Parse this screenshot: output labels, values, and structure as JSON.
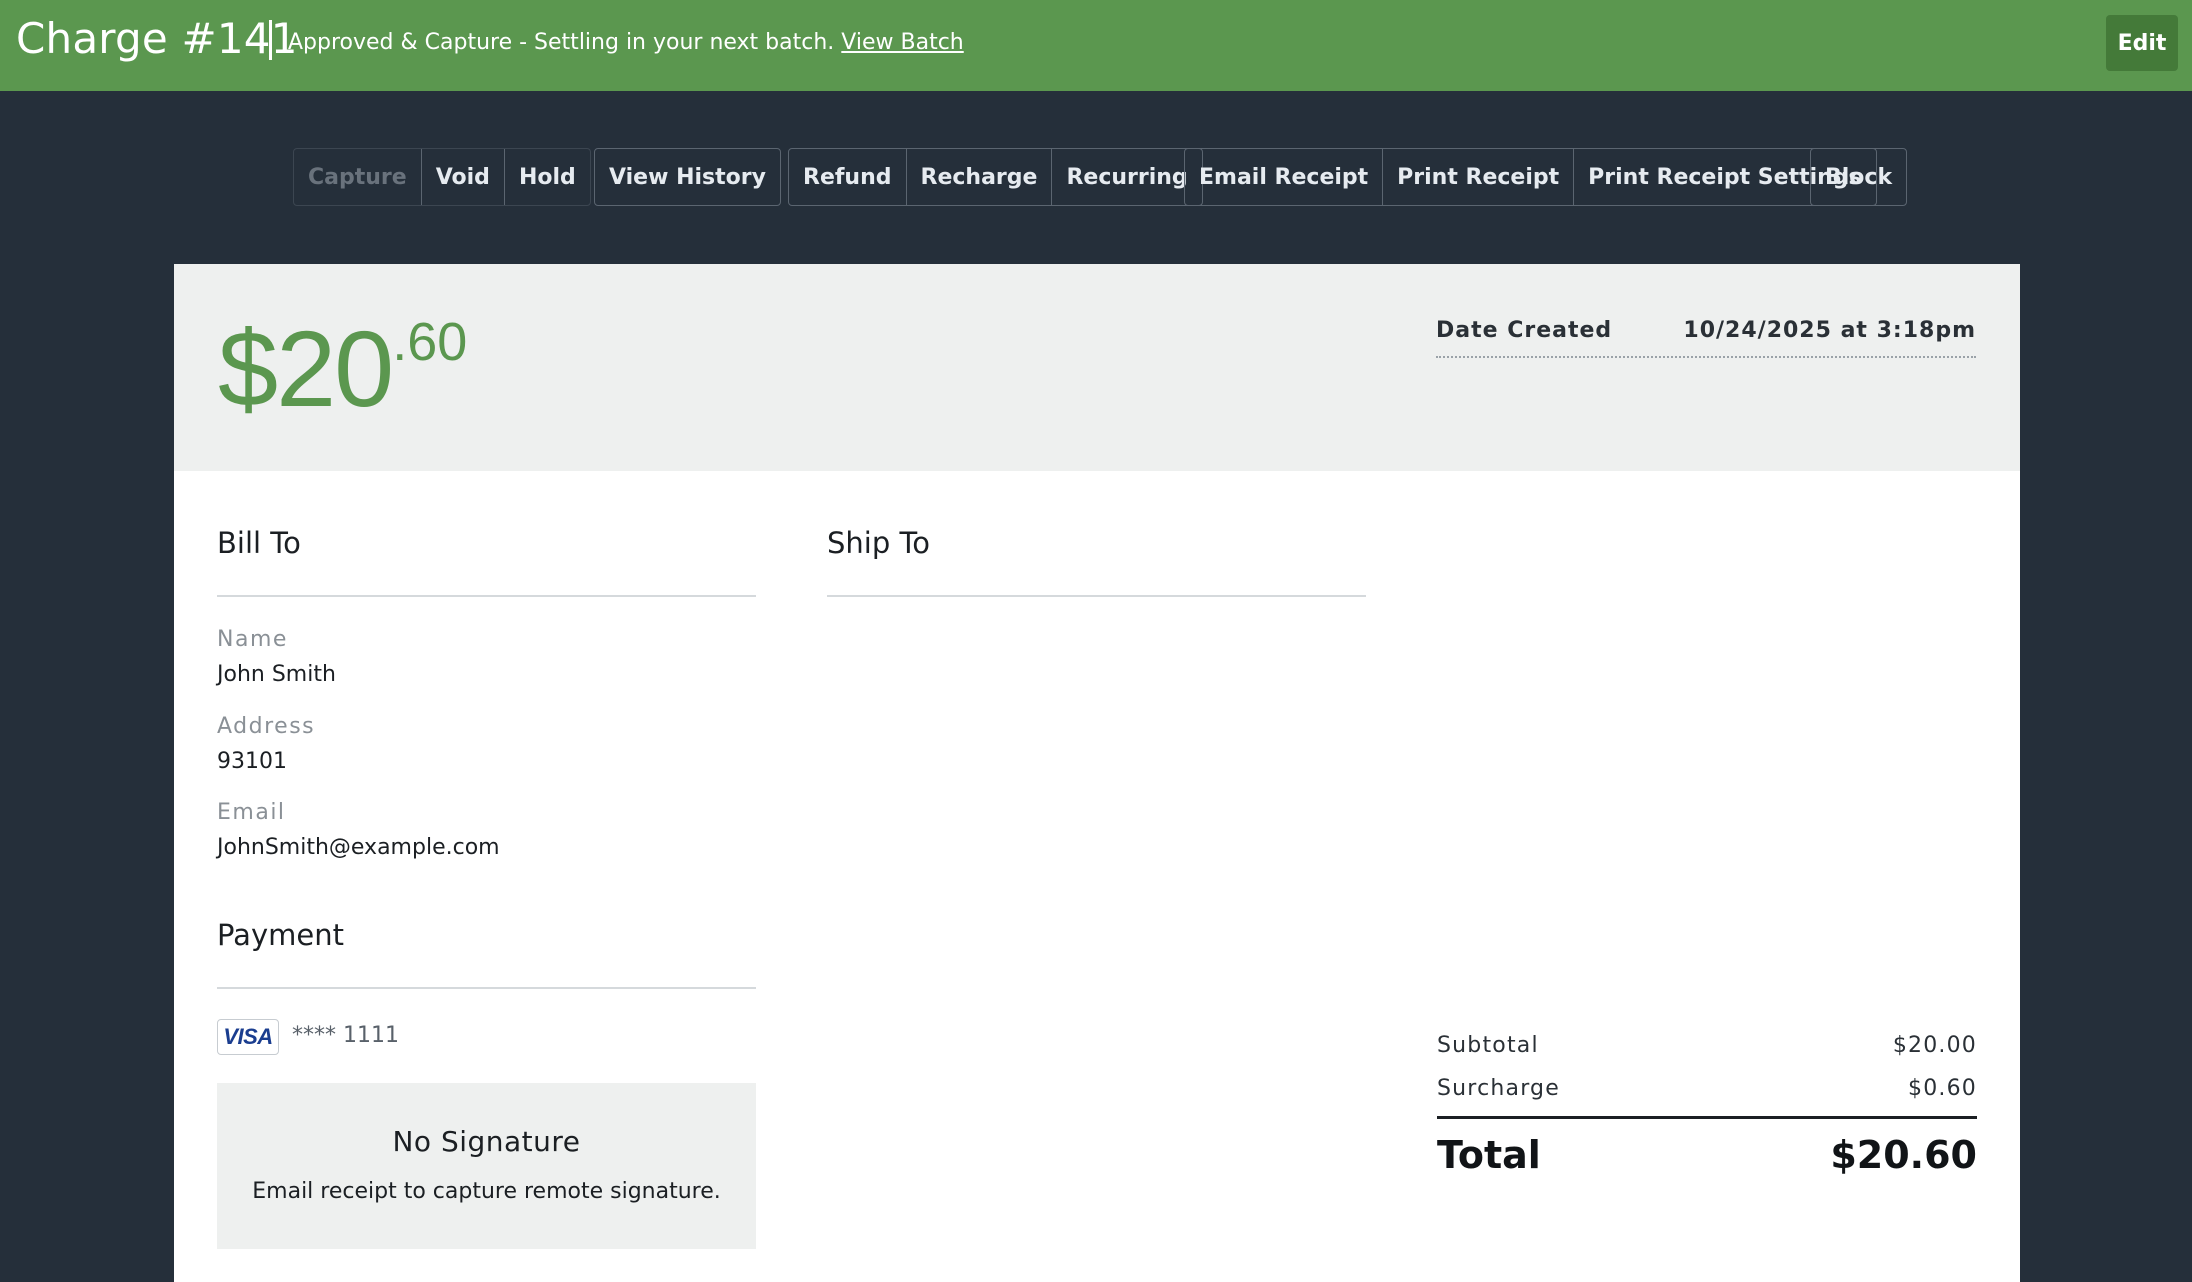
{
  "header": {
    "title": "Charge #141",
    "status_text": "Approved & Capture - Settling in your next batch.",
    "view_batch_label": "View Batch",
    "edit_label": "Edit"
  },
  "toolbar": {
    "groups": [
      [
        {
          "label": "Capture",
          "disabled": true
        },
        {
          "label": "Void"
        },
        {
          "label": "Hold"
        }
      ],
      [
        {
          "label": "View History"
        }
      ],
      [
        {
          "label": "Refund"
        },
        {
          "label": "Recharge"
        },
        {
          "label": "Recurring"
        }
      ],
      [
        {
          "label": "Email Receipt"
        },
        {
          "label": "Print Receipt"
        },
        {
          "label": "Print Receipt Settings"
        }
      ],
      [
        {
          "label": "Block"
        }
      ]
    ]
  },
  "summary": {
    "amount_main": "$20",
    "amount_cents": ".60",
    "date_label": "Date Created",
    "date_value": "10/24/2025 at 3:18pm"
  },
  "bill_to": {
    "title": "Bill To",
    "name_label": "Name",
    "name_value": "John Smith",
    "address_label": "Address",
    "address_value": "93101",
    "email_label": "Email",
    "email_value": "JohnSmith@example.com"
  },
  "ship_to": {
    "title": "Ship To"
  },
  "payment": {
    "title": "Payment",
    "card_brand": "VISA",
    "card_mask": "**** 1111",
    "signature_title": "No Signature",
    "signature_sub": "Email receipt to capture remote signature."
  },
  "totals": {
    "subtotal_label": "Subtotal",
    "subtotal_value": "$20.00",
    "surcharge_label": "Surcharge",
    "surcharge_value": "$0.60",
    "total_label": "Total",
    "total_value": "$20.60"
  },
  "colors": {
    "brand_green": "#5b974f",
    "edit_green": "#447a39",
    "page_bg": "#252f3a",
    "card_head_bg": "#eef0ef"
  }
}
